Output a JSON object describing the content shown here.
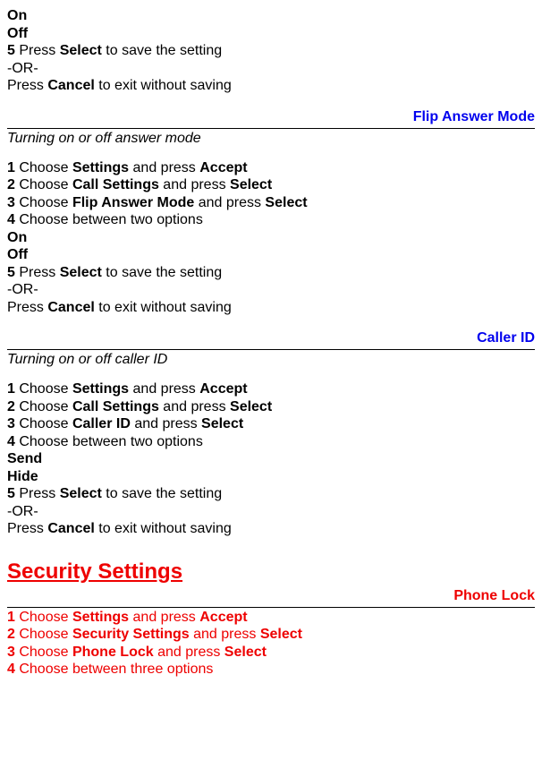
{
  "s0": {
    "opt1": "On",
    "opt2": "Off",
    "step5_num": "5",
    "step5_a": " Press ",
    "step5_b": "Select",
    "step5_c": " to save the setting",
    "or": "-OR-",
    "step5d_a": "Press ",
    "step5d_b": "Cancel",
    "step5d_c": " to exit without saving"
  },
  "h1": "Flip Answer Mode",
  "s1": {
    "subtitle": "Turning on or off answer mode",
    "step1_num": "1",
    "step1_a": " Choose ",
    "step1_b": "Settings",
    "step1_c": " and press ",
    "step1_d": "Accept",
    "step2_num": "2",
    "step2_a": " Choose ",
    "step2_b": "Call Settings",
    "step2_c": " and press ",
    "step2_d": "Select",
    "step3_num": "3",
    "step3_a": " Choose ",
    "step3_b": "Flip Answer Mode",
    "step3_c": " and press ",
    "step3_d": "Select",
    "step4_num": "4",
    "step4_a": " Choose between two options",
    "opt1": "On",
    "opt2": "Off",
    "step5_num": "5",
    "step5_a": " Press ",
    "step5_b": "Select",
    "step5_c": " to save the setting",
    "or": "-OR-",
    "step5d_a": "Press ",
    "step5d_b": "Cancel",
    "step5d_c": " to exit without saving"
  },
  "h2": "Caller ID",
  "s2": {
    "subtitle": "Turning on or off caller ID",
    "step1_num": "1",
    "step1_a": " Choose ",
    "step1_b": "Settings",
    "step1_c": " and press ",
    "step1_d": "Accept",
    "step2_num": "2",
    "step2_a": " Choose ",
    "step2_b": "Call Settings",
    "step2_c": " and press ",
    "step2_d": "Select",
    "step3_num": "3",
    "step3_a": " Choose ",
    "step3_b": "Caller ID",
    "step3_c": " and press ",
    "step3_d": "Select",
    "step4_num": "4",
    "step4_a": " Choose between two options",
    "opt1": "Send",
    "opt2": "Hide",
    "step5_num": "5",
    "step5_a": " Press ",
    "step5_b": "Select",
    "step5_c": " to save the setting",
    "or": "-OR-",
    "step5d_a": "Press ",
    "step5d_b": "Cancel",
    "step5d_c": " to exit without saving"
  },
  "major": "Security Settings",
  "h3": "Phone Lock",
  "s3": {
    "step1_num": "1",
    "step1_a": " Choose ",
    "step1_b": "Settings",
    "step1_c": " and press ",
    "step1_d": "Accept",
    "step2_num": "2",
    "step2_a": " Choose ",
    "step2_b": "Security Settings",
    "step2_c": " and press ",
    "step2_d": "Select",
    "step3_num": "3",
    "step3_a": " Choose ",
    "step3_b": "Phone Lock",
    "step3_c": " and press ",
    "step3_d": "Select",
    "step4_num": "4",
    "step4_a": " Choose between three options"
  }
}
